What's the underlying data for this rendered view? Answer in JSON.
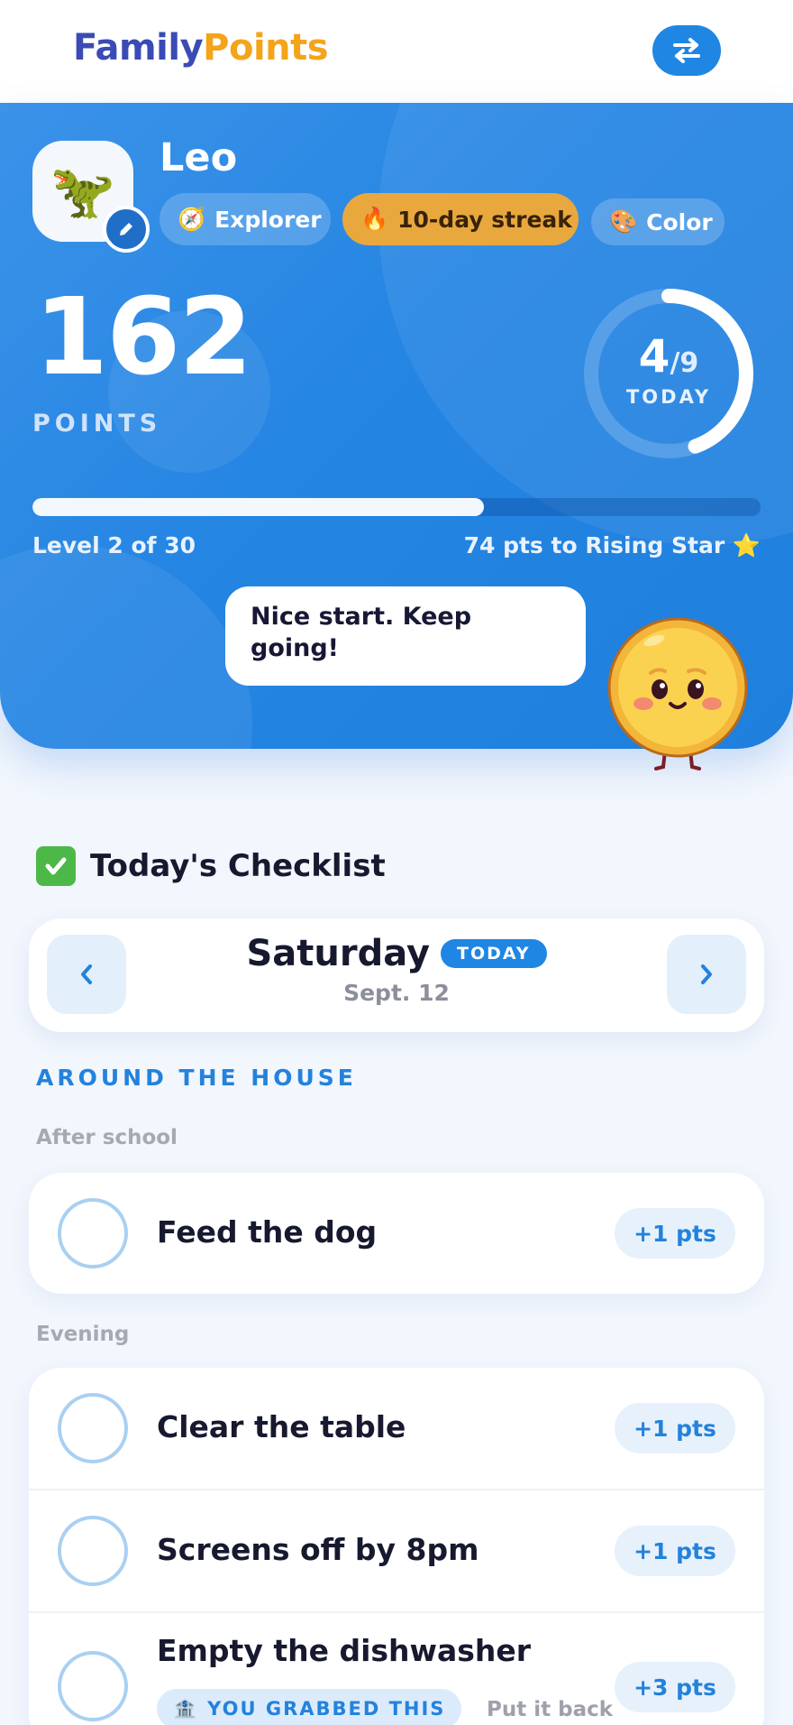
{
  "header": {
    "brand_part1": "Family",
    "brand_part2": "Points",
    "switch_icon": "swap-arrows-icon"
  },
  "profile": {
    "avatar_icon": "t-rex-icon",
    "avatar_emoji": "🦖",
    "name": "Leo",
    "badges": [
      {
        "icon": "compass-icon",
        "glyph": "🧭",
        "label": "Explorer"
      },
      {
        "icon": "fire-icon",
        "glyph": "🔥",
        "label": "10-day streak"
      },
      {
        "icon": "palette-icon",
        "glyph": "🎨",
        "label": "Color"
      }
    ],
    "points": "162",
    "points_label": "POINTS",
    "today_done": "4",
    "today_total": "/9",
    "today_label": "TODAY",
    "today_fraction": 0.444,
    "level_progress": 0.62,
    "level_text": "Level 2 of 30",
    "next_text": "74 pts to Rising Star ⭐",
    "speech": "Nice start. Keep going!",
    "mascot_icon": "coin-mascot-icon"
  },
  "checklist": {
    "title": "Today's Checklist",
    "day_name": "Saturday",
    "today_pill": "TODAY",
    "date": "Sept. 12",
    "area": "AROUND THE HOUSE",
    "groups": [
      {
        "time": "After school",
        "tasks": [
          {
            "name": "Feed the dog",
            "points": "+1 pts"
          }
        ]
      },
      {
        "time": "Evening",
        "tasks": [
          {
            "name": "Clear the table",
            "points": "+1 pts"
          },
          {
            "name": "Screens off by 8pm",
            "points": "+1 pts"
          },
          {
            "name": "Empty the dishwasher",
            "points": "+3 pts",
            "grabbed": "YOU GRABBED THIS",
            "grab_icon": "bank-icon",
            "grab_glyph": "🏦",
            "put_back": "Put it back"
          }
        ]
      }
    ]
  },
  "colors": {
    "brand_blue": "#3a4bb5",
    "brand_orange": "#f4a419",
    "accent": "#1f86e3",
    "streak": "#e8a83e",
    "check_ring": "#a9d0f2"
  }
}
